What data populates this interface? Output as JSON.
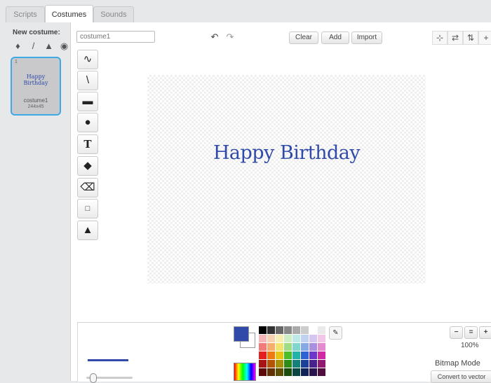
{
  "tabs": [
    {
      "label": "Scripts"
    },
    {
      "label": "Costumes"
    },
    {
      "label": "Sounds"
    }
  ],
  "left_panel": {
    "new_costume_label": "New costume:",
    "costume": {
      "number": "1",
      "thumbnail_text": "Happy Birthday",
      "name": "costume1",
      "size": "244x45"
    }
  },
  "editor": {
    "name_placeholder": "costume1",
    "clear_label": "Clear",
    "add_label": "Add",
    "import_label": "Import",
    "canvas_text": "Happy Birthday",
    "zoom_level": "100%",
    "mode_label": "Bitmap Mode",
    "convert_label": "Convert to vector"
  },
  "colors": {
    "accent": "#2f4aa8",
    "selection": "#3fa9e6"
  }
}
